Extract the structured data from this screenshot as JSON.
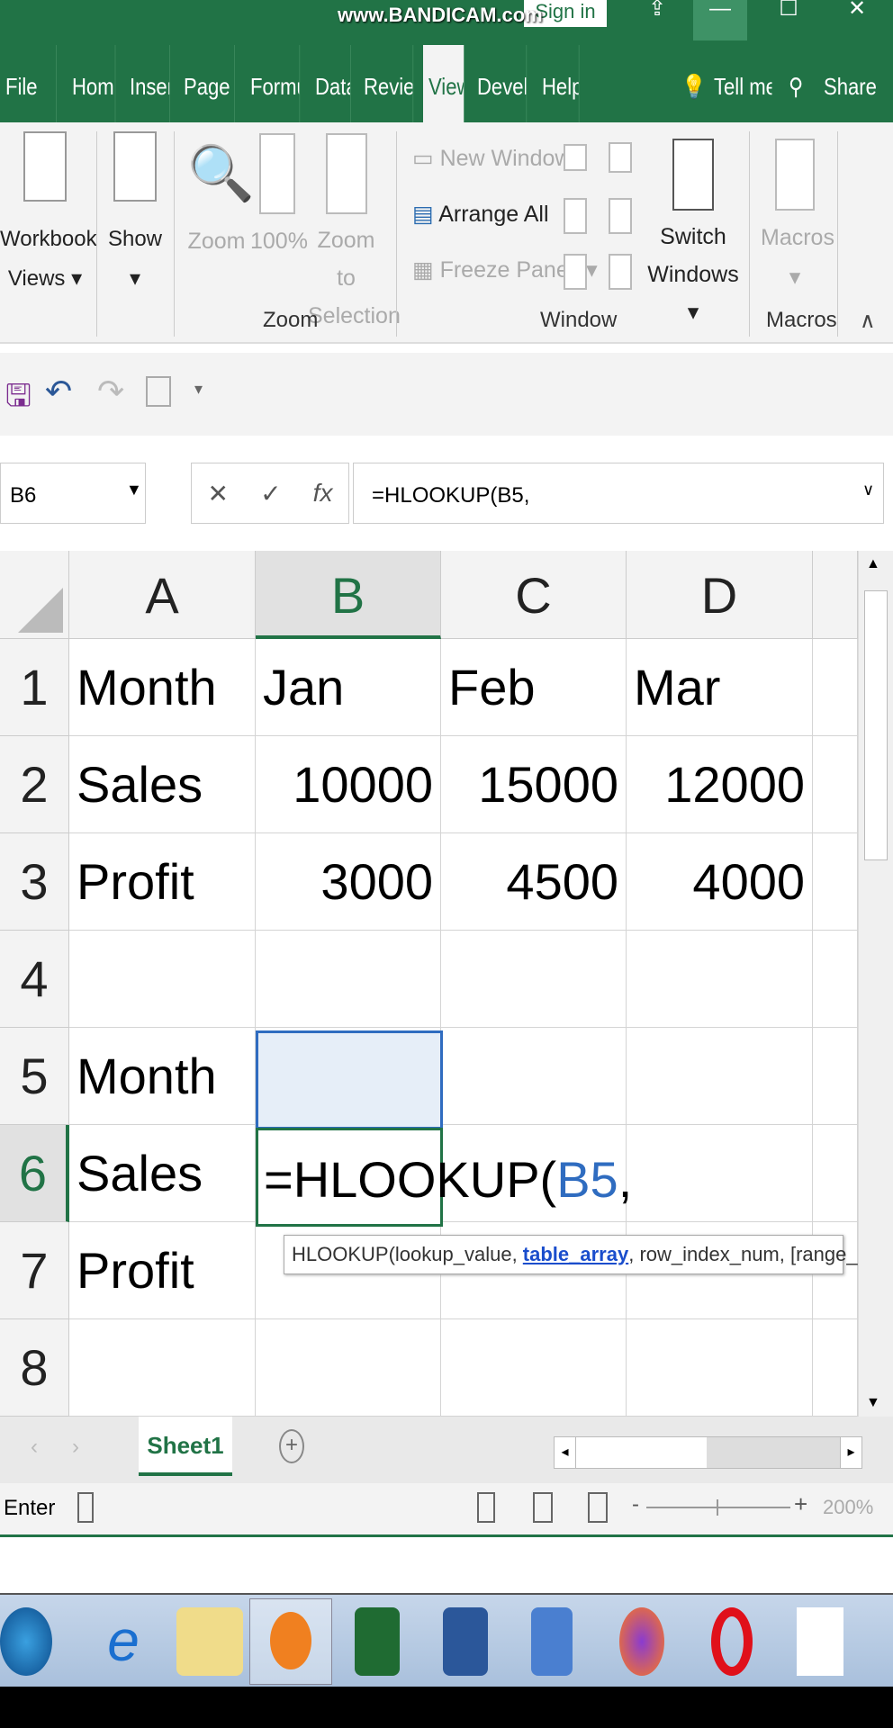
{
  "titlebar": {
    "watermark": "www.BANDICAM.com",
    "sign_in": "Sign in",
    "minimize": "—",
    "maximize": "☐",
    "close": "✕"
  },
  "tabs": [
    "File",
    "Home",
    "Insert",
    "Page La",
    "Formul",
    "Data",
    "Review",
    "View",
    "Develo",
    "Help"
  ],
  "tell_me": "Tell me",
  "share": "Share",
  "ribbon": {
    "workbook_views": "Workbook Views ▾",
    "show": "Show ▾",
    "zoom": "Zoom",
    "zoom100": "100%",
    "zoom_to_selection": "Zoom to Selection",
    "zoom_group": "Zoom",
    "new_window": "New Window",
    "arrange_all": "Arrange All",
    "freeze_panes": "Freeze Panes ▾",
    "switch_windows": "Switch Windows ▾",
    "window_group": "Window",
    "macros": "Macros",
    "macros_dropdown": "▾",
    "macros_group": "Macros",
    "collapse": "∧"
  },
  "formula_bar": {
    "name_box": "B6",
    "cancel": "✕",
    "enter": "✓",
    "fx": "fx",
    "formula": "=HLOOKUP(B5,"
  },
  "columns": [
    "A",
    "B",
    "C",
    "D"
  ],
  "rows": [
    {
      "n": "1",
      "cells": [
        "Month",
        "Jan",
        "Feb",
        "Mar"
      ]
    },
    {
      "n": "2",
      "cells": [
        "Sales",
        "10000",
        "15000",
        "12000"
      ]
    },
    {
      "n": "3",
      "cells": [
        "Profit",
        "3000",
        "4500",
        "4000"
      ]
    },
    {
      "n": "4",
      "cells": [
        "",
        "",
        "",
        ""
      ]
    },
    {
      "n": "5",
      "cells": [
        "Month",
        "",
        "",
        ""
      ]
    },
    {
      "n": "6",
      "cells": [
        "Sales",
        "",
        "",
        ""
      ]
    },
    {
      "n": "7",
      "cells": [
        "Profit",
        "",
        "",
        ""
      ]
    },
    {
      "n": "8",
      "cells": [
        "",
        "",
        "",
        ""
      ]
    }
  ],
  "edit_cell": {
    "prefix": "=HLOOKUP(",
    "ref": "B5",
    "suffix": ","
  },
  "tooltip": {
    "fn": "HLOOKUP(lookup_value, ",
    "active": "table_array",
    "rest": ", row_index_num, [range_lookup])"
  },
  "sheet_tab": "Sheet1",
  "add_sheet": "+",
  "status": {
    "mode": "Enter",
    "zoom": "200%",
    "zoom_minus": "-",
    "zoom_plus": "+"
  }
}
